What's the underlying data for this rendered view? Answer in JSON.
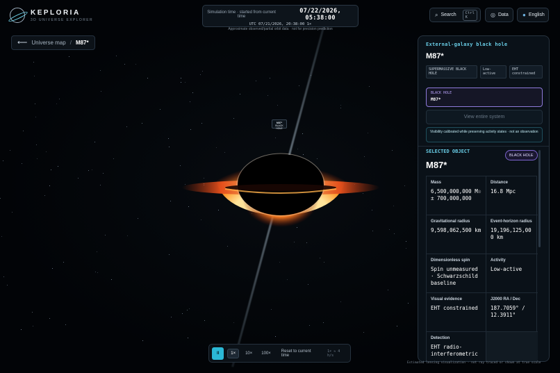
{
  "app": {
    "title": "KEPLORIA",
    "subtitle": "3D UNIVERSE EXPLORER"
  },
  "breadcrumb": {
    "parent": "Universe map",
    "separator": "/",
    "current": "M87*"
  },
  "time": {
    "prefix": "Simulation time · started from current time",
    "value": "07/22/2026, 05:38:00",
    "utc": "UTC 07/21/2026, 20:38:00  1×",
    "note": "Approximate observed/partial orbit data · not for precision prediction"
  },
  "topbar": {
    "search_label": "Search",
    "search_shortcut": "Ctrl K",
    "data_label": "Data",
    "language_label": "English"
  },
  "scene": {
    "object_chip_title": "M87*",
    "object_chip_sub": "BLACK HOLE"
  },
  "panel": {
    "kicker": "External-galaxy black hole",
    "title": "M87*",
    "tags": [
      "SUPERMASSIVE BLACK HOLE",
      "Low-active",
      "EHT constrained"
    ],
    "select_label": "BLACK HOLE",
    "select_value": "M87*",
    "view_button": "View entire system",
    "visibility_note": "Visibility calibrated while preserving activity states · not an observation",
    "selected_kicker": "SELECTED OBJECT",
    "selected_title": "M87*",
    "selected_badge": "BLACK HOLE",
    "props": [
      {
        "label": "Mass",
        "value": "6,500,000,000 M☉ ± 700,000,000"
      },
      {
        "label": "Distance",
        "value": "16.8 Mpc"
      },
      {
        "label": "Gravitational radius",
        "value": "9,598,062,500 km"
      },
      {
        "label": "Event-horizon radius",
        "value": "19,196,125,000 km"
      },
      {
        "label": "Dimensionless spin",
        "value": "Spin unmeasured · Schwarzschild baseline"
      },
      {
        "label": "Activity",
        "value": "Low-active"
      },
      {
        "label": "Visual evidence",
        "value": "EHT constrained"
      },
      {
        "label": "J2000 RA / Dec",
        "value": "187.7059° / 12.3911°"
      },
      {
        "label": "Detection",
        "value": "EHT radio-interferometric"
      },
      {
        "label": "",
        "value": ""
      }
    ]
  },
  "controls": {
    "pause_label": "II",
    "speeds": [
      "1×",
      "10×",
      "100×"
    ],
    "active_speed": "1×",
    "reset_label": "Reset to current time",
    "rate": "1× ≈ 4 h/s"
  },
  "footnote": "Estimated lensing visualization · not ray traced or shown at true scale",
  "colors": {
    "accent": "#2bb8d6",
    "kicker": "#69cde6",
    "purple": "#8e7adb",
    "disk_hot": "#ffd36b",
    "disk_outer": "#e4461a"
  }
}
